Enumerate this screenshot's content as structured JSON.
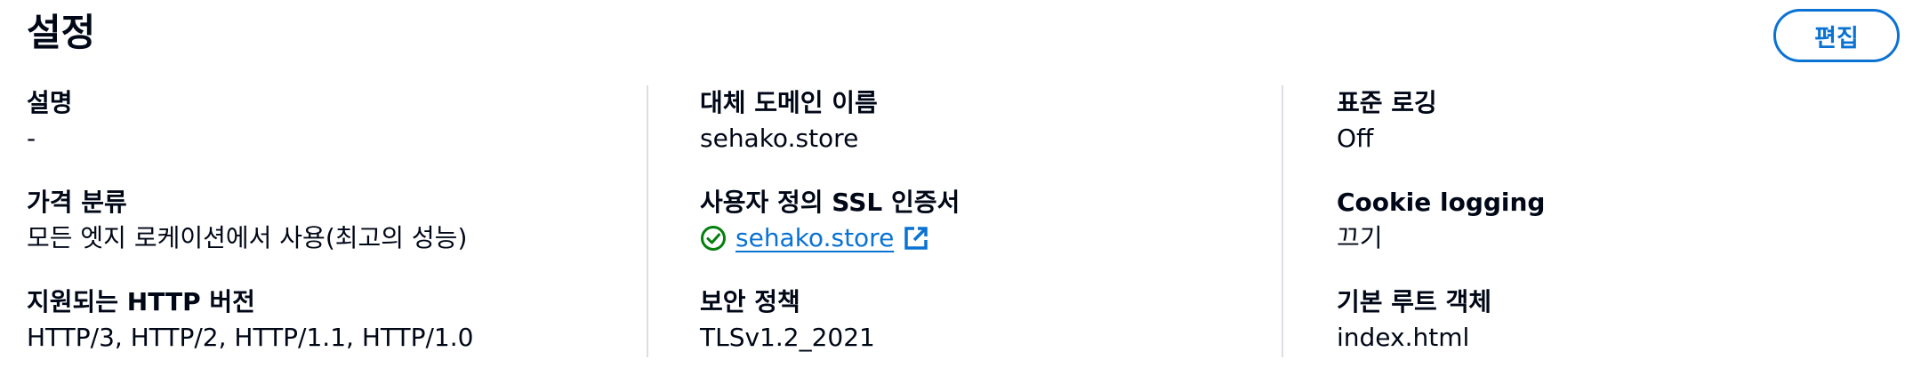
{
  "header": {
    "title": "설정",
    "edit_label": "편집"
  },
  "columns": [
    {
      "fields": [
        {
          "label": "설명",
          "value": "-"
        },
        {
          "label": "가격 분류",
          "value": "모든 엣지 로케이션에서 사용(최고의 성능)"
        },
        {
          "label": "지원되는 HTTP 버전",
          "value": "HTTP/3, HTTP/2, HTTP/1.1, HTTP/1.0"
        }
      ]
    },
    {
      "fields": [
        {
          "label": "대체 도메인 이름",
          "value": "sehako.store"
        },
        {
          "label": "사용자 정의 SSL 인증서",
          "value": "sehako.store",
          "status_icon": "check-circle-icon",
          "status_color": "#037f0c",
          "link_icon": "external-link-icon"
        },
        {
          "label": "보안 정책",
          "value": "TLSv1.2_2021"
        }
      ]
    },
    {
      "fields": [
        {
          "label": "표준 로깅",
          "value": "Off"
        },
        {
          "label": "Cookie logging",
          "value": "끄기"
        },
        {
          "label": "기본 루트 객체",
          "value": "index.html"
        }
      ]
    }
  ],
  "colors": {
    "accent": "#0972d3",
    "success": "#037f0c",
    "text": "#000716",
    "divider": "#dcdee3"
  }
}
